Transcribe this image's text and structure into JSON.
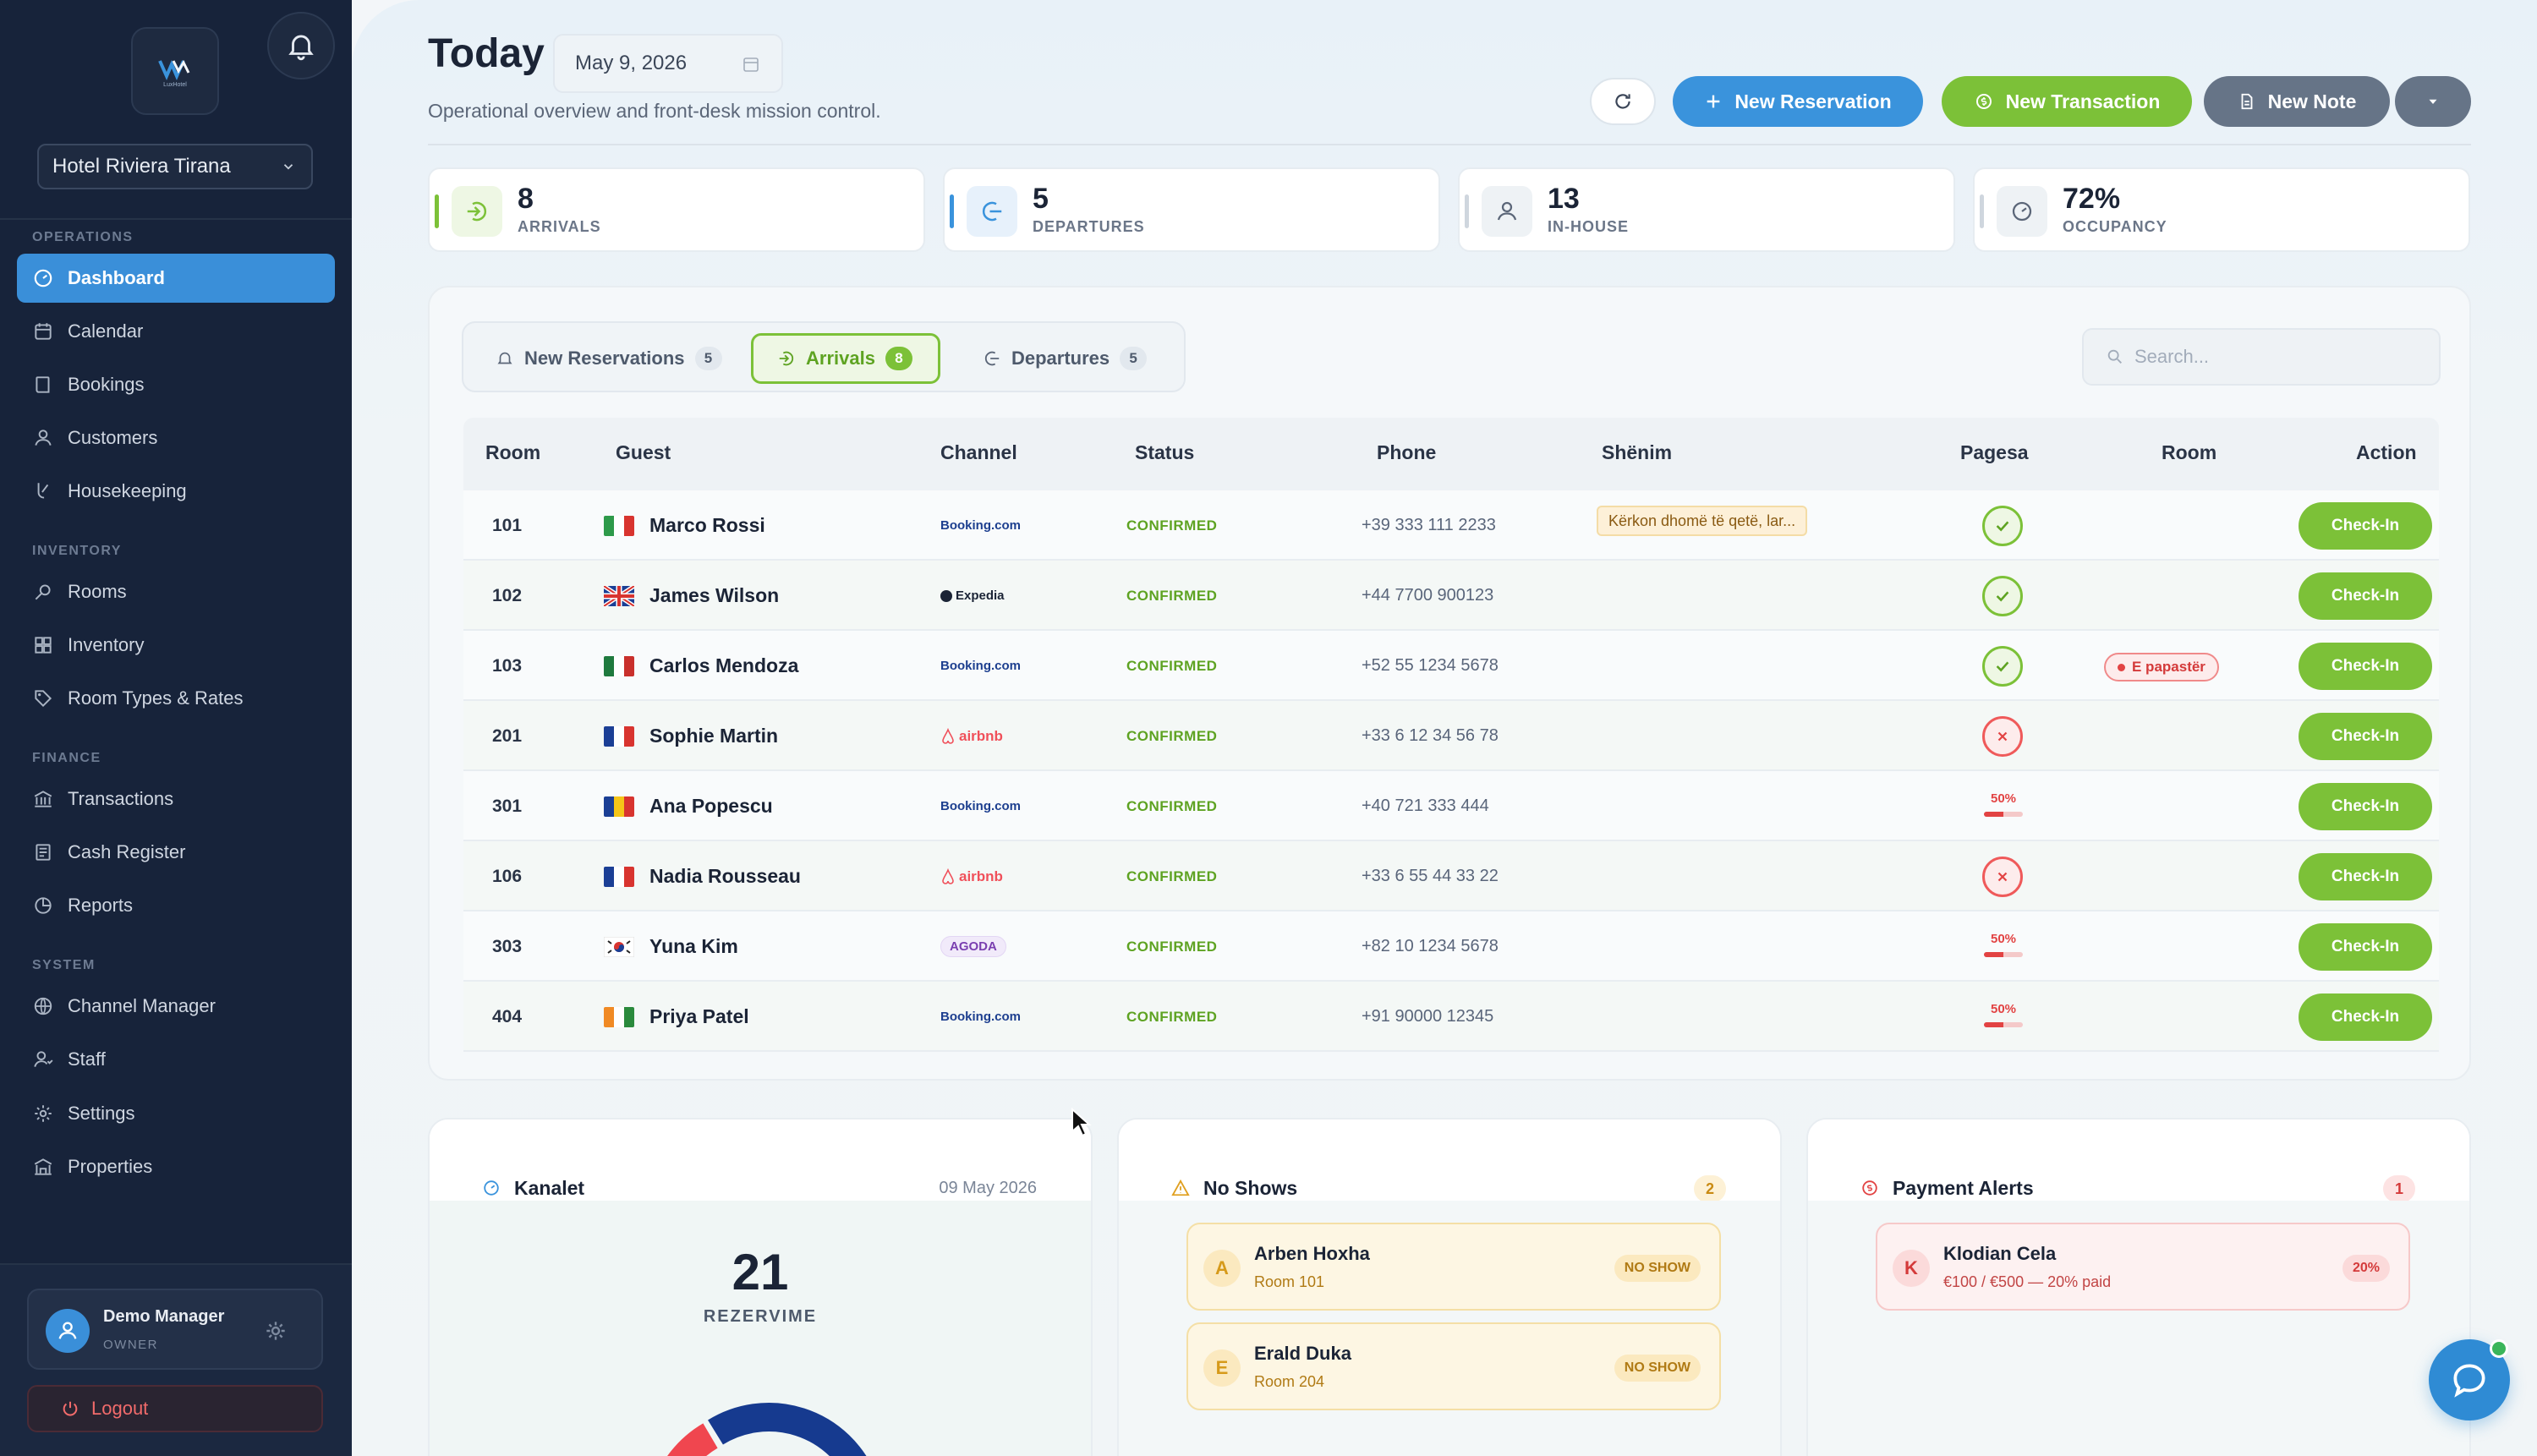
{
  "sidebar": {
    "logo_text": "LuxHotel",
    "hotel_select": "Hotel Riviera Tirana",
    "sections": {
      "operations": "OPERATIONS",
      "inventory": "INVENTORY",
      "finance": "FINANCE",
      "system": "SYSTEM"
    },
    "items": {
      "dashboard": "Dashboard",
      "calendar": "Calendar",
      "bookings": "Bookings",
      "customers": "Customers",
      "housekeeping": "Housekeeping",
      "rooms": "Rooms",
      "inventory": "Inventory",
      "room_types": "Room Types & Rates",
      "transactions": "Transactions",
      "cash_register": "Cash Register",
      "reports": "Reports",
      "channel_manager": "Channel Manager",
      "staff": "Staff",
      "settings": "Settings",
      "properties": "Properties"
    },
    "user": {
      "name": "Demo Manager",
      "role": "OWNER"
    },
    "logout": "Logout"
  },
  "header": {
    "title": "Today",
    "date": "May 9, 2026",
    "subtitle": "Operational overview and front-desk mission control.",
    "buttons": {
      "new_reservation": "New Reservation",
      "new_transaction": "New Transaction",
      "new_note": "New Note"
    }
  },
  "stats": [
    {
      "value": "8",
      "label": "ARRIVALS",
      "color": "#7cc138"
    },
    {
      "value": "5",
      "label": "DEPARTURES",
      "color": "#3a93dc"
    },
    {
      "value": "13",
      "label": "IN-HOUSE",
      "color": "#cfd6de"
    },
    {
      "value": "72%",
      "label": "OCCUPANCY",
      "color": "#cfd6de"
    }
  ],
  "tabs": [
    {
      "label": "New Reservations",
      "count": "5"
    },
    {
      "label": "Arrivals",
      "count": "8"
    },
    {
      "label": "Departures",
      "count": "5"
    }
  ],
  "search": {
    "placeholder": "Search..."
  },
  "table": {
    "headers": {
      "room": "Room",
      "guest": "Guest",
      "channel": "Channel",
      "status": "Status",
      "phone": "Phone",
      "note": "Shënim",
      "payment": "Pagesa",
      "room2": "Room",
      "action": "Action"
    },
    "rows": [
      {
        "room": "101",
        "guest": "Marco Rossi",
        "flag": "it",
        "channel": "Booking.com",
        "status": "CONFIRMED",
        "phone": "+39 333 111 2233",
        "note": "Kërkon dhomë të qetë, lar...",
        "payment": "paid",
        "payment_pct": "",
        "room_tag": "",
        "action": "Check-In"
      },
      {
        "room": "102",
        "guest": "James Wilson",
        "flag": "gb",
        "channel": "Expedia",
        "status": "CONFIRMED",
        "phone": "+44 7700 900123",
        "note": "",
        "payment": "paid",
        "payment_pct": "",
        "room_tag": "",
        "action": "Check-In"
      },
      {
        "room": "103",
        "guest": "Carlos Mendoza",
        "flag": "mx",
        "channel": "Booking.com",
        "status": "CONFIRMED",
        "phone": "+52 55 1234 5678",
        "note": "",
        "payment": "paid",
        "payment_pct": "",
        "room_tag": "E papastër",
        "action": "Check-In"
      },
      {
        "room": "201",
        "guest": "Sophie Martin",
        "flag": "fr",
        "channel": "airbnb",
        "status": "CONFIRMED",
        "phone": "+33 6 12 34 56 78",
        "note": "",
        "payment": "unpaid",
        "payment_pct": "",
        "room_tag": "",
        "action": "Check-In"
      },
      {
        "room": "301",
        "guest": "Ana Popescu",
        "flag": "ro",
        "channel": "Booking.com",
        "status": "CONFIRMED",
        "phone": "+40 721 333 444",
        "note": "",
        "payment": "partial",
        "payment_pct": "50%",
        "room_tag": "",
        "action": "Check-In"
      },
      {
        "room": "106",
        "guest": "Nadia Rousseau",
        "flag": "fr",
        "channel": "airbnb",
        "status": "CONFIRMED",
        "phone": "+33 6 55 44 33 22",
        "note": "",
        "payment": "unpaid",
        "payment_pct": "",
        "room_tag": "",
        "action": "Check-In"
      },
      {
        "room": "303",
        "guest": "Yuna Kim",
        "flag": "kr",
        "channel": "AGODA",
        "status": "CONFIRMED",
        "phone": "+82 10 1234 5678",
        "note": "",
        "payment": "partial",
        "payment_pct": "50%",
        "room_tag": "",
        "action": "Check-In"
      },
      {
        "room": "404",
        "guest": "Priya Patel",
        "flag": "in",
        "channel": "Booking.com",
        "status": "CONFIRMED",
        "phone": "+91 90000 12345",
        "note": "",
        "payment": "partial",
        "payment_pct": "50%",
        "room_tag": "",
        "action": "Check-In"
      }
    ]
  },
  "kanalet": {
    "title": "Kanalet",
    "date": "09 May 2026",
    "total": "21",
    "total_label": "REZERVIME"
  },
  "no_shows": {
    "title": "No Shows",
    "count": "2",
    "items": [
      {
        "initial": "A",
        "name": "Arben Hoxha",
        "room": "Room 101",
        "tag": "NO SHOW"
      },
      {
        "initial": "E",
        "name": "Erald Duka",
        "room": "Room 204",
        "tag": "NO SHOW"
      }
    ]
  },
  "payment_alerts": {
    "title": "Payment Alerts",
    "count": "1",
    "items": [
      {
        "initial": "K",
        "name": "Klodian Cela",
        "detail": "€100 / €500 — 20% paid",
        "tag": "20%"
      }
    ]
  },
  "colors": {
    "accent_blue": "#3a93dc",
    "accent_green": "#7cc138",
    "sidebar_bg": "#17233a",
    "danger": "#e24343",
    "warning": "#e0a020"
  }
}
